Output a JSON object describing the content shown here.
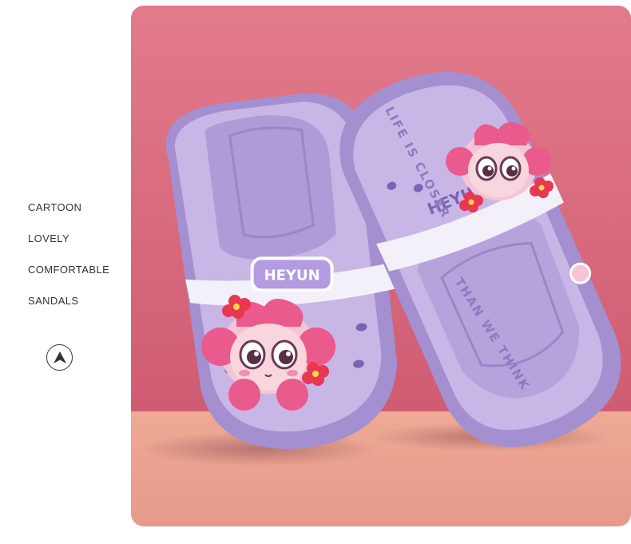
{
  "features": [
    "CARTOON",
    "LOVELY",
    "COMFORTABLE",
    "SANDALS"
  ],
  "nav_icon": "up-arrow-circle-icon",
  "photo": {
    "subject": "kids-clog-sandals-photo",
    "strap_brand": "HEYUN",
    "side_brand": "HEYUN",
    "sole_text_left": "LIFE IS CLOSER",
    "sole_text_right": "THAN WE THINK",
    "colors": {
      "wall": "#d9687e",
      "floor": "#e9a08c",
      "sandal": "#c8b6e6",
      "sandal_dark": "#a48fd0",
      "accent_pink": "#e95a8c"
    }
  }
}
